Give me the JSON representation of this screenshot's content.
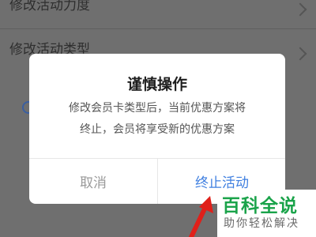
{
  "background": {
    "rows": [
      {
        "label": "修改活动力度"
      },
      {
        "label": "修改活动类型"
      }
    ]
  },
  "dialog": {
    "title": "谨慎操作",
    "message_lines": [
      "修改会员卡类型后，当前优惠方案将",
      "终止，会员将享受新的优惠方案"
    ],
    "cancel_label": "取消",
    "confirm_label": "终止活动",
    "confirm_color": "#3f7fe0"
  },
  "watermark": {
    "title": "百科全说",
    "subtitle": "助你轻松解决"
  }
}
